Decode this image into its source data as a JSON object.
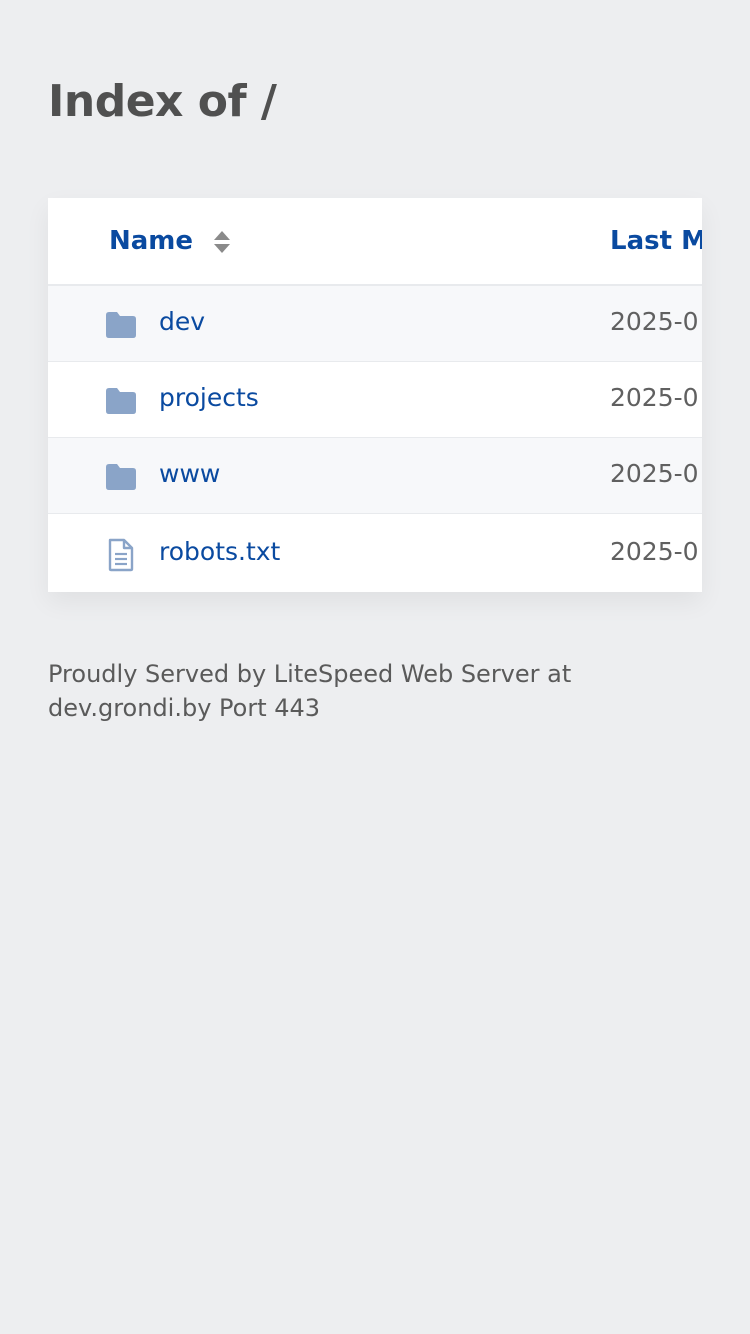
{
  "page": {
    "title": "Index of /"
  },
  "table": {
    "columns": {
      "name": "Name",
      "modified": "Last Me"
    },
    "rows": [
      {
        "name": "dev",
        "type": "folder",
        "modified": "2025-0"
      },
      {
        "name": "projects",
        "type": "folder",
        "modified": "2025-0"
      },
      {
        "name": "www",
        "type": "folder",
        "modified": "2025-0"
      },
      {
        "name": "robots.txt",
        "type": "file",
        "modified": "2025-0"
      }
    ]
  },
  "footer": {
    "text": "Proudly Served by LiteSpeed Web Server at dev.grondi.by Port 443"
  },
  "colors": {
    "background": "#edeef0",
    "link": "#0a4aa0",
    "folder_icon": "#8aa4c8"
  },
  "icons": {
    "folder": "folder-icon",
    "file": "file-text-icon",
    "sort": "sort-icon"
  }
}
